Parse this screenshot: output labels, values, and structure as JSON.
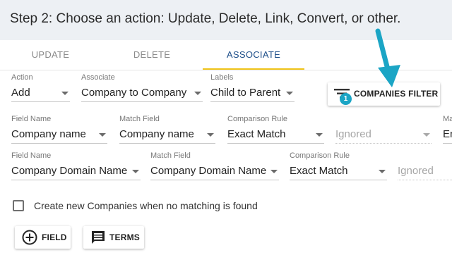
{
  "header": {
    "title": "Step 2: Choose an action: Update, Delete, Link, Convert, or other."
  },
  "tabs": [
    {
      "label": "UPDATE",
      "active": false
    },
    {
      "label": "DELETE",
      "active": false
    },
    {
      "label": "ASSOCIATE",
      "active": true
    }
  ],
  "row1": {
    "action": {
      "label": "Action",
      "value": "Add"
    },
    "associate": {
      "label": "Associate",
      "value": "Company to Company"
    },
    "labels": {
      "label": "Labels",
      "value": "Child to Parent"
    },
    "filter_button": {
      "label": "COMPANIES FILTER",
      "badge": "1",
      "icon": "filter-icon"
    }
  },
  "row2": {
    "field_name": {
      "label": "Field Name",
      "value": "Company name"
    },
    "match_field": {
      "label": "Match Field",
      "value": "Company name"
    },
    "comparison_rule": {
      "label": "Comparison Rule",
      "value": "Exact Match"
    },
    "ignored": {
      "value": "Ignored"
    },
    "cut_label": "Ma",
    "cut_value": "En"
  },
  "row3": {
    "field_name": {
      "label": "Field Name",
      "value": "Company Domain Name"
    },
    "match_field": {
      "label": "Match Field",
      "value": "Company Domain Name"
    },
    "comparison_rule": {
      "label": "Comparison Rule",
      "value": "Exact Match"
    },
    "ignored": {
      "value": "Ignored"
    }
  },
  "create_new": {
    "label": "Create new Companies when no matching is found",
    "checked": false
  },
  "buttons": {
    "field": {
      "label": "FIELD",
      "icon": "add-circle-icon"
    },
    "terms": {
      "label": "TERMS",
      "icon": "comment-icon"
    }
  },
  "colors": {
    "tab_underline": "#f0c419",
    "active_tab": "#1e4f8a",
    "accent": "#1ba5c5",
    "header_bg": "#edf0f4"
  }
}
